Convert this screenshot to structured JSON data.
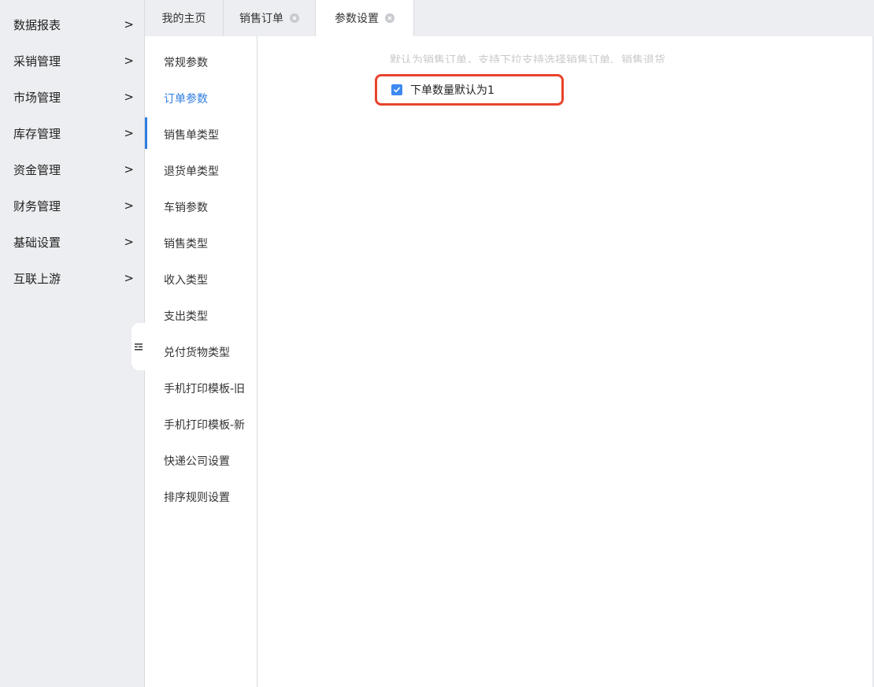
{
  "main_nav": {
    "items": [
      {
        "label": "数据报表"
      },
      {
        "label": "采销管理"
      },
      {
        "label": "市场管理"
      },
      {
        "label": "库存管理"
      },
      {
        "label": "资金管理"
      },
      {
        "label": "财务管理"
      },
      {
        "label": "基础设置"
      },
      {
        "label": "互联上游"
      }
    ],
    "chevron": ">"
  },
  "tabs": [
    {
      "label": "我的主页",
      "closable": false
    },
    {
      "label": "销售订单",
      "closable": true
    },
    {
      "label": "参数设置",
      "closable": true,
      "active": true
    }
  ],
  "sub_nav": {
    "active_index": 1,
    "items": [
      {
        "label": "常规参数"
      },
      {
        "label": "订单参数"
      },
      {
        "label": "销售单类型"
      },
      {
        "label": "退货单类型"
      },
      {
        "label": "车销参数"
      },
      {
        "label": "销售类型"
      },
      {
        "label": "收入类型"
      },
      {
        "label": "支出类型"
      },
      {
        "label": "兑付货物类型"
      },
      {
        "label": "手机打印模板-旧"
      },
      {
        "label": "手机打印模板-新"
      },
      {
        "label": "快递公司设置"
      },
      {
        "label": "排序规则设置"
      }
    ]
  },
  "content": {
    "faded_text": "默认为销售订单，支持下拉支持选择销售订单、销售退货",
    "checkbox": {
      "label": "下单数量默认为1",
      "checked": true
    }
  },
  "colors": {
    "accent": "#2f7de1",
    "checkbox": "#3d89f0",
    "highlight_border": "#e8432d",
    "nav_bg": "#edeef1"
  },
  "icons": {
    "chevron": "chevron-right-icon",
    "close": "close-circle-icon",
    "check": "checkmark-icon",
    "collapse": "collapse-sidebar-icon"
  }
}
